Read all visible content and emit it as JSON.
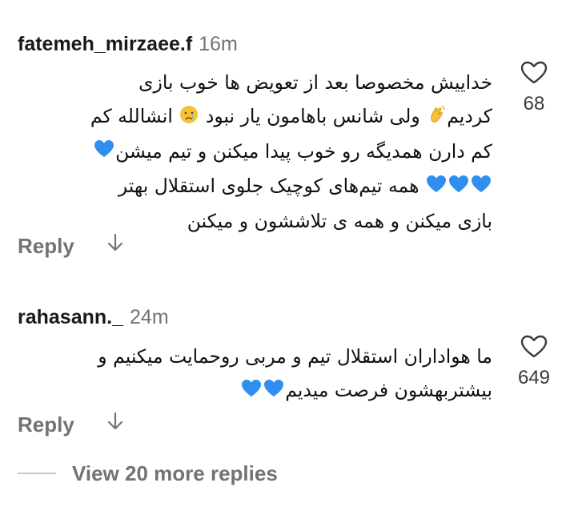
{
  "comments": [
    {
      "username": "fatemeh_mirzaee.f",
      "time": "16m",
      "lines": [
        "خداییش مخصوصا بعد از تعویض ها خوب بازی",
        [
          "کردیم",
          "clap-emoji",
          " ولی شانس باهامون یار نبود ",
          "sad-emoji",
          " انشالله کم"
        ],
        [
          "کم دارن همدیگه رو خوب پیدا میکنن و تیم میشن",
          "blue-heart-emoji"
        ],
        [
          [
            "blue-heart-emoji",
            "blue-heart-emoji",
            "blue-heart-emoji"
          ],
          " همه تیم‌های کوچیک جلوی استقلال بهتر"
        ],
        "بازی میکنن و همه ی تلاششون و میکنن"
      ],
      "likes": "68",
      "reply_label": "Reply"
    },
    {
      "username": "rahasann._",
      "time": "24m",
      "lines": [
        "ما هواداران استقلال تیم و مربی روحمایت میکنیم و",
        [
          "بیشتربهشون فرصت میدیم",
          "blue-heart-emoji",
          "blue-heart-emoji"
        ]
      ],
      "likes": "649",
      "reply_label": "Reply"
    }
  ],
  "line_text": {
    "c0_l0": "خداییش مخصوصا بعد از تعویض ها خوب بازی",
    "c0_l1a": "کردیم",
    "c0_l1b": " ولی شانس باهامون یار نبود ",
    "c0_l1c": " انشالله کم",
    "c0_l2": "کم دارن همدیگه رو خوب پیدا میکنن و تیم میشن",
    "c0_l3": " همه تیم‌های کوچیک جلوی استقلال بهتر",
    "c0_l4": "بازی میکنن و همه ی تلاششون و میکنن",
    "c1_l0": "ما هواداران استقلال تیم و مربی روحمایت میکنیم و",
    "c1_l1": "بیشتربهشون فرصت میدیم"
  },
  "more_replies_label": "View 20 more replies",
  "colors": {
    "text": "#111111",
    "muted": "#737373",
    "heart_blue": "#2f8ff0"
  }
}
